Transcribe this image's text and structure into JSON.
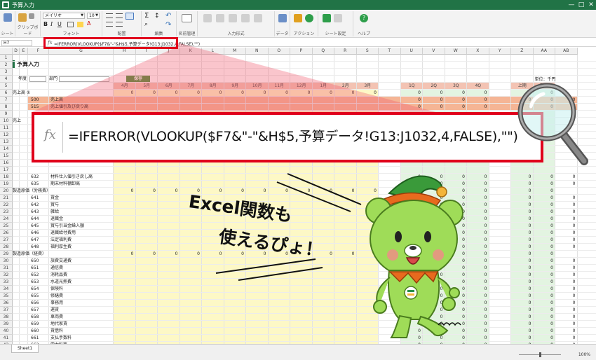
{
  "window": {
    "title": "予算入力",
    "controls": [
      "—",
      "□",
      "✕"
    ]
  },
  "ribbon": {
    "groups": [
      {
        "label": "シート"
      },
      {
        "label": "クリップボード"
      },
      {
        "label": "フォント"
      },
      {
        "label": "配置"
      },
      {
        "label": "編集"
      },
      {
        "label": "名前管理"
      },
      {
        "label": "入力形式"
      },
      {
        "label": "データ"
      },
      {
        "label": "アクション"
      },
      {
        "label": "シート設定"
      },
      {
        "label": "ヘルプ"
      }
    ],
    "font_name": "メイリオ",
    "font_size": "10"
  },
  "formula_bar": {
    "name_box": "H7",
    "fx": "fx",
    "formula": "=IFERROR(VLOOKUP($F7&\"-\"&H$5,予算データ!G13:J1032,4,FALSE),\"\")"
  },
  "zoom_formula": {
    "fx": "fx",
    "text": "=IFERROR(VLOOKUP($F7&\"-\"&H$5,予算データ!G13:J1032,4,FALSE),\"\")"
  },
  "sheet": {
    "title": "予算入力",
    "year_label": "年度",
    "dept_label": "部門",
    "save_button": "保存",
    "unit_label": "単位：千円",
    "columns": [
      "D",
      "E",
      "F",
      "G",
      "H",
      "I",
      "J",
      "K",
      "L",
      "M",
      "N",
      "O",
      "P",
      "Q",
      "R",
      "S",
      "T",
      "U",
      "V",
      "W",
      "X",
      "Y",
      "Z",
      "AA",
      "AB"
    ],
    "month_headers": [
      "4月",
      "5月",
      "6月",
      "7月",
      "8月",
      "9月",
      "10月",
      "11月",
      "12月",
      "1月",
      "2月",
      "3月"
    ],
    "quarter_headers": [
      "1Q",
      "2Q",
      "3Q",
      "4Q"
    ],
    "half_headers": [
      "上期",
      "下期"
    ],
    "rows": [
      {
        "num": "1"
      },
      {
        "num": "2"
      },
      {
        "num": "3"
      },
      {
        "num": "4"
      },
      {
        "num": "5"
      },
      {
        "num": "6",
        "section": "売上高",
        "mark": "①",
        "zeros": true
      },
      {
        "num": "7",
        "code": "500",
        "name": "売上高"
      },
      {
        "num": "8",
        "code": "515",
        "name": "売上値引及び戻り高"
      },
      {
        "num": "9"
      },
      {
        "num": "10",
        "section": "売上"
      },
      {
        "num": "11"
      },
      {
        "num": "12"
      },
      {
        "num": "13"
      },
      {
        "num": "14"
      },
      {
        "num": "15"
      },
      {
        "num": "16"
      },
      {
        "num": "17"
      },
      {
        "num": "18",
        "code": "632",
        "name": "材料仕入値引き戻し高"
      },
      {
        "num": "19",
        "code": "635",
        "name": "期末材料棚卸高"
      },
      {
        "num": "20",
        "section": "製造原価（労務費）",
        "zeros": true
      },
      {
        "num": "21",
        "code": "641",
        "name": "賃金"
      },
      {
        "num": "22",
        "code": "642",
        "name": "賞与"
      },
      {
        "num": "23",
        "code": "643",
        "name": "雑給"
      },
      {
        "num": "24",
        "code": "644",
        "name": "退職金"
      },
      {
        "num": "25",
        "code": "645",
        "name": "賞与引当金繰入額"
      },
      {
        "num": "26",
        "code": "646",
        "name": "退職給付費用"
      },
      {
        "num": "27",
        "code": "647",
        "name": "法定福利費"
      },
      {
        "num": "28",
        "code": "648",
        "name": "福利厚生費"
      },
      {
        "num": "29",
        "section": "製造原価（経費）",
        "zeros": true
      },
      {
        "num": "30",
        "code": "650",
        "name": "旅費交通費"
      },
      {
        "num": "31",
        "code": "651",
        "name": "通信費"
      },
      {
        "num": "32",
        "code": "652",
        "name": "消耗品費"
      },
      {
        "num": "33",
        "code": "653",
        "name": "水道光熱費"
      },
      {
        "num": "34",
        "code": "654",
        "name": "保険料"
      },
      {
        "num": "35",
        "code": "655",
        "name": "修繕費"
      },
      {
        "num": "36",
        "code": "656",
        "name": "事務用"
      },
      {
        "num": "37",
        "code": "657",
        "name": "運賃"
      },
      {
        "num": "38",
        "code": "658",
        "name": "車両費"
      },
      {
        "num": "39",
        "code": "659",
        "name": "地代家賃"
      },
      {
        "num": "40",
        "code": "660",
        "name": "賃借料"
      },
      {
        "num": "41",
        "code": "661",
        "name": "支払手数料"
      },
      {
        "num": "42",
        "code": "662",
        "name": "電力料等"
      },
      {
        "num": "43",
        "code": "663",
        "name": "燃料費"
      },
      {
        "num": "44",
        "code": "664",
        "name": "租税公課"
      }
    ],
    "zero": "0"
  },
  "callout": {
    "line1": "Excel関数も",
    "line2": "使えるぴょ！"
  },
  "status": {
    "sheet_tab": "Sheet1",
    "zoom": "100%"
  },
  "colors": {
    "accent_red": "#e0001b",
    "excel_green": "#217346",
    "month_yellow": "#fdf8c6",
    "quarter_green": "#e3f4e1",
    "header_pink": "#f3c3b3",
    "mascot_green": "#9fdc58"
  }
}
